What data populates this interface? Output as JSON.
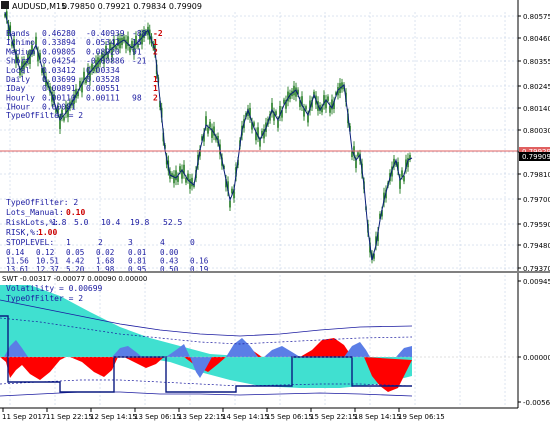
{
  "header": {
    "symbol_line": "AUDUSD,M15",
    "ohlc": "0.79850 0.79921 0.79834 0.79909"
  },
  "price_axis": {
    "ticks": [
      "0.80575",
      "0.80460",
      "0.80355",
      "0.80245",
      "0.80140",
      "0.80030",
      "0.79920",
      "0.79810",
      "0.79700",
      "0.79590",
      "0.79480",
      "0.79370"
    ],
    "red_line_label": "0.79929",
    "current_price_label": "0.79909"
  },
  "indicator_axis": {
    "ticks": [
      "0.00945",
      "0.00000",
      "-0.00561"
    ]
  },
  "time_axis": {
    "ticks": [
      "11 Sep 2017",
      "11 Sep 22:15",
      "12 Sep 14:15",
      "13 Sep 06:15",
      "13 Sep 22:15",
      "14 Sep 14:15",
      "15 Sep 06:15",
      "15 Sep 22:15",
      "18 Sep 14:15",
      "19 Sep 06:15"
    ]
  },
  "strength_panel": {
    "rows": [
      {
        "label": "Bands",
        "v1": "0.46280",
        "v2": "-0.40939",
        "n": "-88",
        "flag": "-2"
      },
      {
        "label": "Ichimo",
        "v1": "0.33894",
        "v2": "0.05342",
        "n": "16",
        "flag": "1"
      },
      {
        "label": "Medium",
        "v1": "0.09805",
        "v2": "0.08920",
        "n": "91",
        "flag": "2"
      },
      {
        "label": "Short",
        "v1": "0.04254",
        "v2": "-0.00886",
        "n": "-21",
        "flag": ""
      },
      {
        "label": "Local",
        "v1": "0.03412",
        "v2": "0.00334",
        "n": "",
        "flag": ""
      },
      {
        "label": "Daily",
        "v1": "0.03699",
        "v2": "0.03528",
        "n": "",
        "flag": "1"
      },
      {
        "label": "IDay",
        "v1": "0.00891",
        "v2": "0.00551",
        "n": "",
        "flag": "1"
      },
      {
        "label": "Hourly",
        "v1": "0.00110",
        "v2": "0.00111",
        "n": "98",
        "flag": "2"
      },
      {
        "label": "IHour",
        "v1": "0.00081",
        "v2": "",
        "n": "",
        "flag": ""
      }
    ],
    "type_of_filter": "TypeOfFilter = 2"
  },
  "risk_panel": {
    "type_of_filter": "TypeOfFilter: 2",
    "lots_label": "Lots_Manual:",
    "lots_value": "0.10",
    "risklots_label": "RiskLots,%:",
    "risklots_values": [
      "1.8",
      "5.0",
      "10.4",
      "19.8",
      "52.5"
    ],
    "risk_label": "RISK,%:",
    "risk_value": "1.00",
    "stoplevel_label": "STOPLEVEL:",
    "stoplevel_values": [
      "1",
      "2",
      "3",
      "4",
      "0"
    ],
    "grid": [
      [
        "0.14",
        "0.12",
        "0.05",
        "0.02",
        "0.01",
        "0.00"
      ],
      [
        "11.56",
        "10.51",
        "4.42",
        "1.68",
        "0.81",
        "0.43",
        "0.16"
      ],
      [
        "13.61",
        "12.37",
        "5.20",
        "1.98",
        "0.95",
        "0.50",
        "0.19"
      ]
    ]
  },
  "indicator": {
    "title": "SWT -0.00317 -0.00077 0.00090 0.00000",
    "volatility": "Volatility  = 0.00699",
    "type_of_filter": "TypeOfFilter = 2"
  },
  "colors": {
    "candle": "#1f7a1f",
    "price_line": "#0b1f7a",
    "red_line": "#e06060",
    "aqua": "#40e0d0",
    "fill_red": "#ff0000",
    "fill_blue": "#5b7ee6",
    "label_blue": "#1a1aa0",
    "label_red": "#cc0000"
  }
}
